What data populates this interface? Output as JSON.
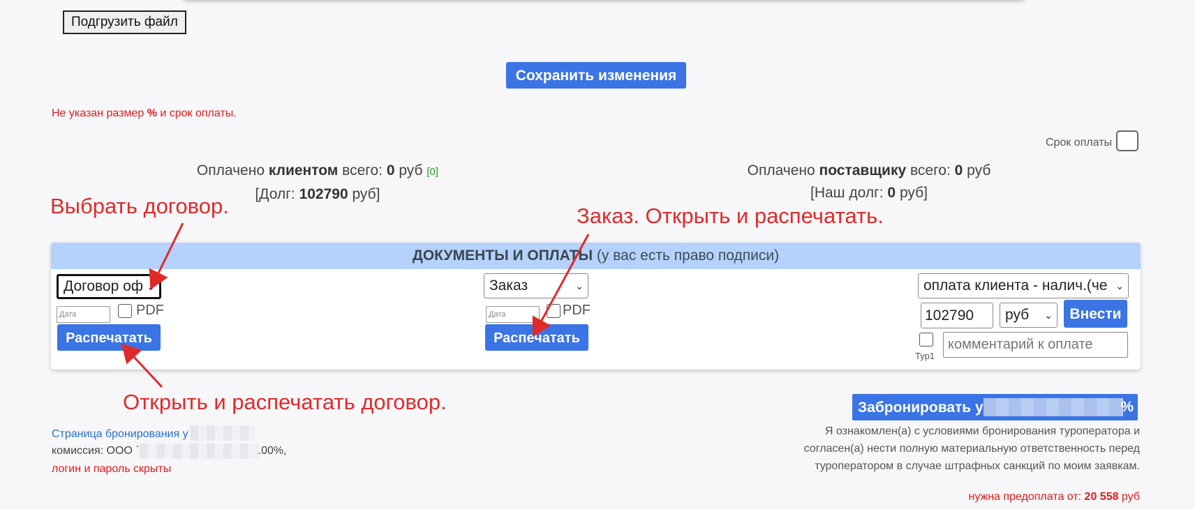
{
  "upload": {
    "label": "Подгрузить файл"
  },
  "save": {
    "label": "Сохранить изменения"
  },
  "warning": {
    "before": "Не указан размер ",
    "pct": "%",
    "after": " и срок оплаты."
  },
  "payment_due": {
    "label": "Срок оплаты"
  },
  "client_paid": {
    "prefix": "Оплачено ",
    "who": "клиентом",
    "middle": " всего: ",
    "amount": "0",
    "unit": " руб ",
    "link": "[0]",
    "debt_prefix": "[Долг: ",
    "debt": "102790",
    "debt_suffix": " руб]"
  },
  "supplier_paid": {
    "prefix": "Оплачено ",
    "who": "поставщику",
    "middle": " всего: ",
    "amount": "0",
    "unit": " руб",
    "debt_prefix": "[Наш долг: ",
    "debt": "0",
    "debt_suffix": " руб]"
  },
  "annotations": {
    "choose_contract": "Выбрать договор.",
    "order": "Заказ. Открыть и распечатать.",
    "print_contract": "Открыть и распечатать договор."
  },
  "panel": {
    "title": "ДОКУМЕНТЫ И ОПЛАТЫ",
    "subtitle": " (у вас есть право подписи)",
    "contract_select": "Договор оф",
    "order_select": "Заказ",
    "date_placeholder": "Дата",
    "pdf_label": "PDF",
    "print_label": "Распечатать",
    "payment_select": "оплата клиента - налич.(че",
    "amount_value": "102790",
    "currency_select": "руб",
    "enter_label": "Внести",
    "tur_label": "Тур1",
    "comment_placeholder": "комментарий к оплате"
  },
  "booking": {
    "button_prefix": "Забронировать у",
    "button_suffix": "%",
    "agree_text": "Я ознакомлен(а) с условиями бронирования туроператора и согласен(а) нести полную материальную ответственность перед туроператором в случае штрафных санкций по моим заявкам.",
    "prepay_prefix": "нужна предоплата от: ",
    "prepay_amount": "20 558",
    "prepay_suffix": " руб"
  },
  "left_info": {
    "booking_link": "Страница бронирования у",
    "commission": "комиссия: ООО `",
    "commission_suffix": ".00%,",
    "login_hidden": "логин и пароль скрыты"
  },
  "colors": {
    "accent": "#3b74e4",
    "panel_header": "#b4d2fb",
    "annotation": "#e02a2a"
  }
}
